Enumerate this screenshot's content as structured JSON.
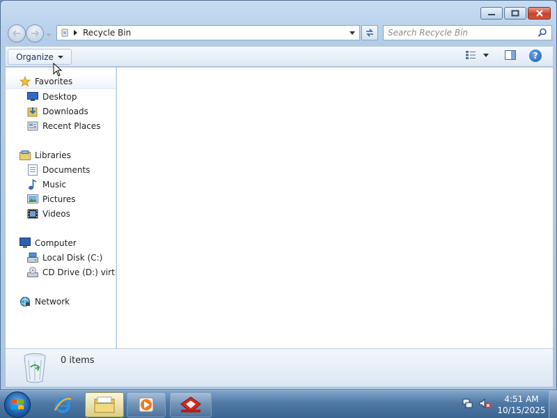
{
  "window": {
    "title_buttons": [
      "minimize",
      "maximize",
      "close"
    ]
  },
  "address_bar": {
    "path": "Recycle Bin",
    "search_placeholder": "Search Recycle Bin"
  },
  "command_bar": {
    "organize_label": "Organize"
  },
  "nav_pane": {
    "favorites": {
      "label": "Favorites",
      "items": [
        {
          "label": "Desktop",
          "icon": "desktop-icon"
        },
        {
          "label": "Downloads",
          "icon": "downloads-icon"
        },
        {
          "label": "Recent Places",
          "icon": "recent-places-icon"
        }
      ]
    },
    "libraries": {
      "label": "Libraries",
      "items": [
        {
          "label": "Documents",
          "icon": "documents-icon"
        },
        {
          "label": "Music",
          "icon": "music-icon"
        },
        {
          "label": "Pictures",
          "icon": "pictures-icon"
        },
        {
          "label": "Videos",
          "icon": "videos-icon"
        }
      ]
    },
    "computer": {
      "label": "Computer",
      "items": [
        {
          "label": "Local Disk (C:)",
          "icon": "local-disk-icon"
        },
        {
          "label": "CD Drive (D:) virtio-w",
          "icon": "cd-drive-icon"
        }
      ]
    },
    "network": {
      "label": "Network"
    }
  },
  "details_pane": {
    "item_count": "0 items"
  },
  "taskbar": {
    "apps": [
      "internet-explorer",
      "windows-explorer",
      "windows-media-player",
      "red-app"
    ],
    "time": "4:51 AM",
    "date": "10/15/2025"
  }
}
